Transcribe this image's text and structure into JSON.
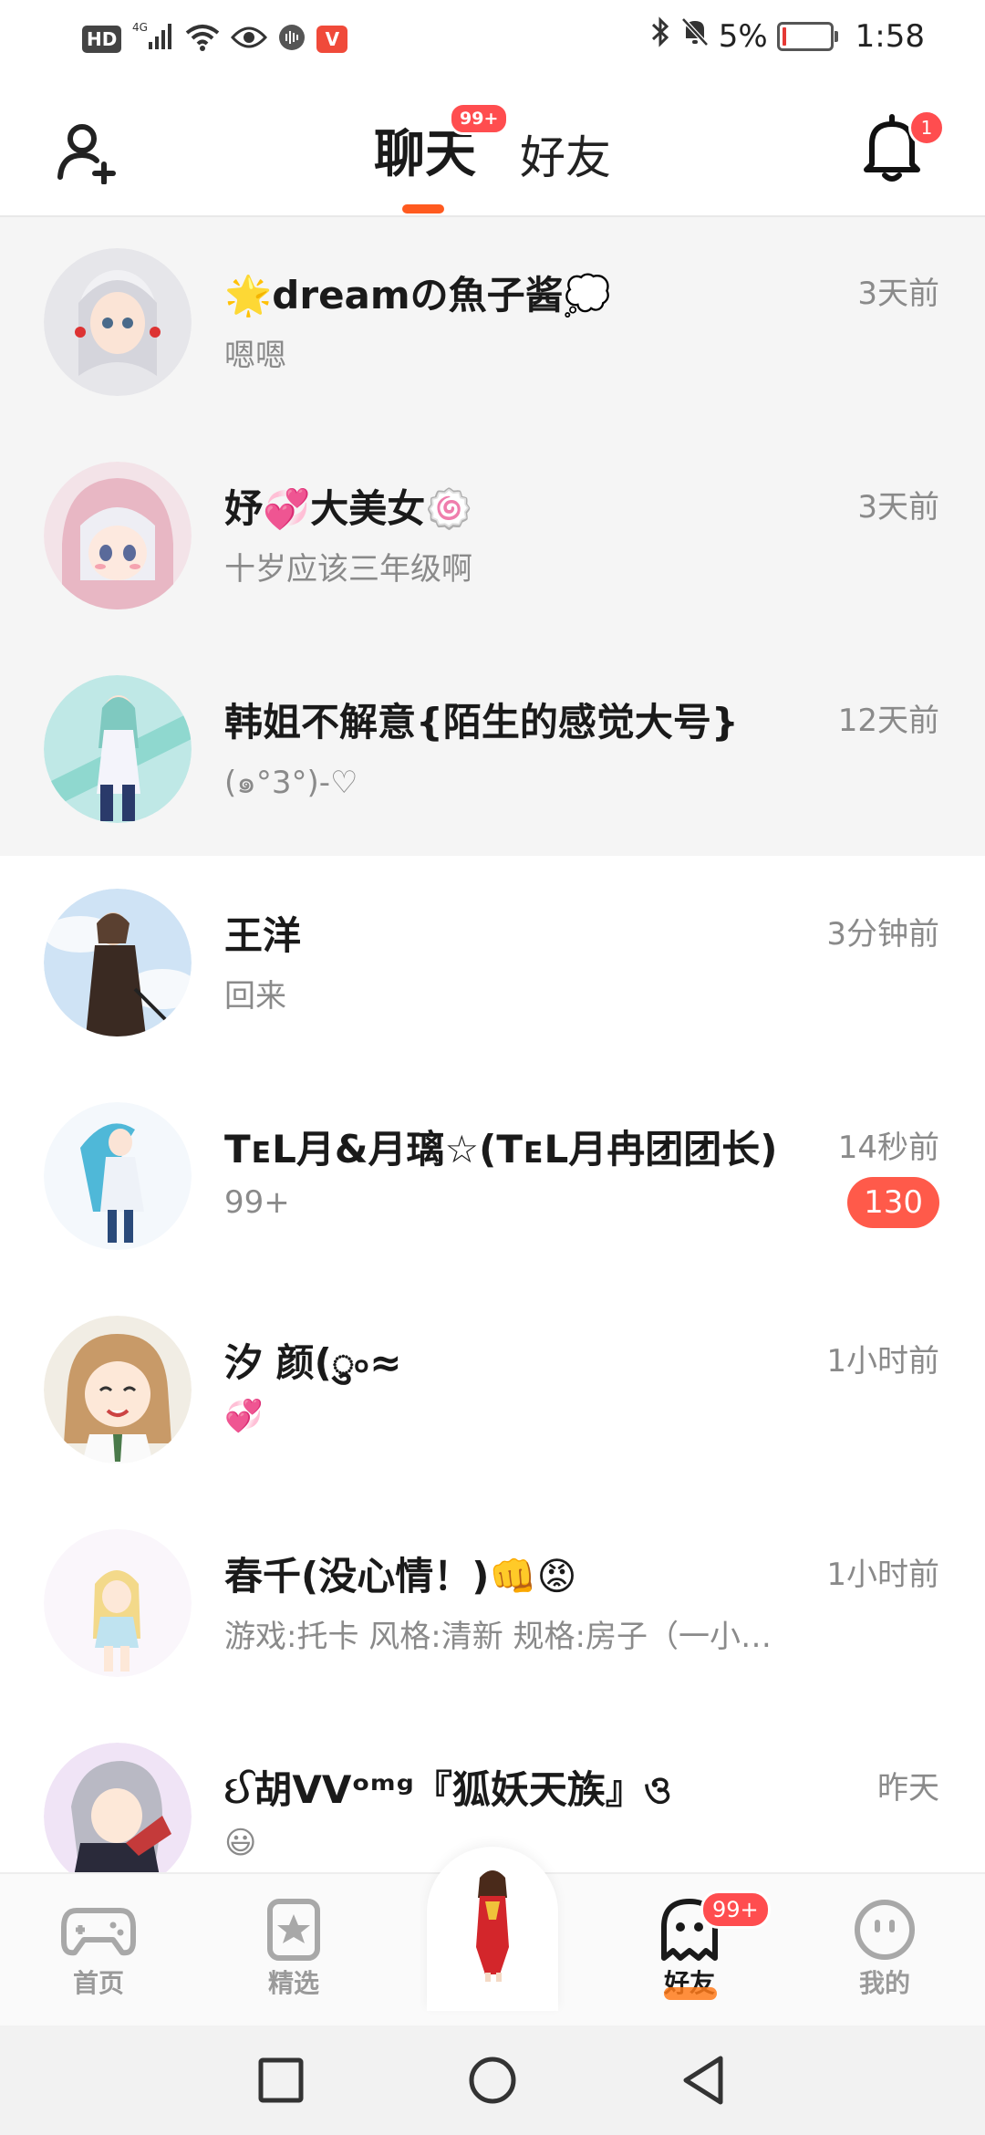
{
  "status_bar": {
    "hd": "HD",
    "network": "4G",
    "v_icon": "V",
    "battery_percent": "5%",
    "time": "1:58",
    "icons": [
      "signal-icon",
      "wifi-icon",
      "eye-icon",
      "voice-icon",
      "bluetooth-icon",
      "mute-bell-icon",
      "battery-icon"
    ]
  },
  "header": {
    "tabs": [
      {
        "label": "聊天",
        "active": true,
        "badge": "99+"
      },
      {
        "label": "好友",
        "active": false
      }
    ],
    "notification_badge": "1",
    "accent": "#ff5a1f"
  },
  "chats": [
    {
      "name": "🌟dreamの魚子酱💭",
      "preview": "嗯嗯",
      "time": "3天前",
      "pinned": true
    },
    {
      "name": "妤💞大美女🍥",
      "preview": "十岁应该三年级啊",
      "time": "3天前",
      "pinned": true
    },
    {
      "name": "韩姐不解意{陌生的感觉大号}",
      "preview": "(๑°3°)-♡",
      "time": "12天前",
      "pinned": true
    },
    {
      "name": "王洋",
      "preview": "回来",
      "time": "3分钟前",
      "pinned": false
    },
    {
      "name": "TᴇL月&月璃☆(TᴇL月冉团团长)",
      "preview": "99+",
      "time": "14秒前",
      "badge": "130",
      "pinned": false
    },
    {
      "name": "汐 颜(ु৹≈",
      "preview": "💞",
      "time": "1小时前",
      "pinned": false
    },
    {
      "name": "春千(没心情！)👊😡",
      "preview": "游戏:托卡 风格:清新 规格:房子（一小…",
      "time": "1小时前",
      "pinned": false
    },
    {
      "name": "ઈ胡VVᵒᵐᵍ『狐妖天族』ও",
      "preview": "😃",
      "time": "昨天",
      "pinned": false
    }
  ],
  "bottom_nav": {
    "items": [
      {
        "label": "首页",
        "icon": "gamepad-icon",
        "active": false
      },
      {
        "label": "精选",
        "icon": "star-bookmark-icon",
        "active": false
      },
      {
        "label": "",
        "icon": "character-avatar-icon",
        "active": false
      },
      {
        "label": "好友",
        "icon": "ghost-icon",
        "active": true,
        "badge": "99+"
      },
      {
        "label": "我的",
        "icon": "face-icon",
        "active": false
      }
    ]
  },
  "system_nav": [
    "square-icon",
    "circle-icon",
    "back-triangle-icon"
  ]
}
